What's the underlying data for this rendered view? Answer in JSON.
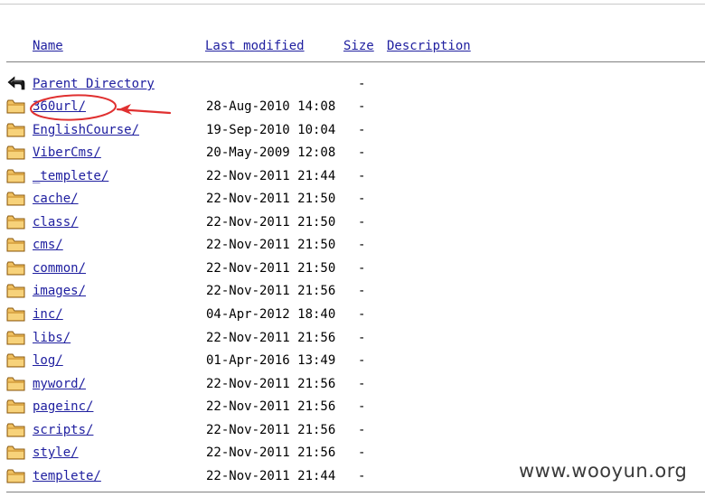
{
  "columns": {
    "name": "Name",
    "last_modified": "Last modified",
    "size": "Size",
    "description": "Description"
  },
  "parent": {
    "label": "Parent Directory",
    "size": "-",
    "icon": "back-arrow-icon"
  },
  "entries": [
    {
      "name": "360url/",
      "modified": "28-Aug-2010 14:08",
      "size": "-",
      "icon": "folder-icon",
      "highlighted": true
    },
    {
      "name": "EnglishCourse/",
      "modified": "19-Sep-2010 10:04",
      "size": "-",
      "icon": "folder-icon"
    },
    {
      "name": "ViberCms/",
      "modified": "20-May-2009 12:08",
      "size": "-",
      "icon": "folder-icon"
    },
    {
      "name": "_templete/",
      "modified": "22-Nov-2011 21:44",
      "size": "-",
      "icon": "folder-icon"
    },
    {
      "name": "cache/",
      "modified": "22-Nov-2011 21:50",
      "size": "-",
      "icon": "folder-icon"
    },
    {
      "name": "class/",
      "modified": "22-Nov-2011 21:50",
      "size": "-",
      "icon": "folder-icon"
    },
    {
      "name": "cms/",
      "modified": "22-Nov-2011 21:50",
      "size": "-",
      "icon": "folder-icon"
    },
    {
      "name": "common/",
      "modified": "22-Nov-2011 21:50",
      "size": "-",
      "icon": "folder-icon"
    },
    {
      "name": "images/",
      "modified": "22-Nov-2011 21:56",
      "size": "-",
      "icon": "folder-icon"
    },
    {
      "name": "inc/",
      "modified": "04-Apr-2012 18:40",
      "size": "-",
      "icon": "folder-icon"
    },
    {
      "name": "libs/",
      "modified": "22-Nov-2011 21:56",
      "size": "-",
      "icon": "folder-icon"
    },
    {
      "name": "log/",
      "modified": "01-Apr-2016 13:49",
      "size": "-",
      "icon": "folder-icon"
    },
    {
      "name": "myword/",
      "modified": "22-Nov-2011 21:56",
      "size": "-",
      "icon": "folder-icon"
    },
    {
      "name": "pageinc/",
      "modified": "22-Nov-2011 21:56",
      "size": "-",
      "icon": "folder-icon"
    },
    {
      "name": "scripts/",
      "modified": "22-Nov-2011 21:56",
      "size": "-",
      "icon": "folder-icon"
    },
    {
      "name": "style/",
      "modified": "22-Nov-2011 21:56",
      "size": "-",
      "icon": "folder-icon"
    },
    {
      "name": "templete/",
      "modified": "22-Nov-2011 21:44",
      "size": "-",
      "icon": "folder-icon"
    }
  ],
  "annotation": {
    "color": "#e03030"
  },
  "watermark": "www.wooyun.org",
  "colors": {
    "link": "#2020a0",
    "rule": "#808080",
    "folder_fill": "#f0c060",
    "folder_stroke": "#8a5a10"
  }
}
